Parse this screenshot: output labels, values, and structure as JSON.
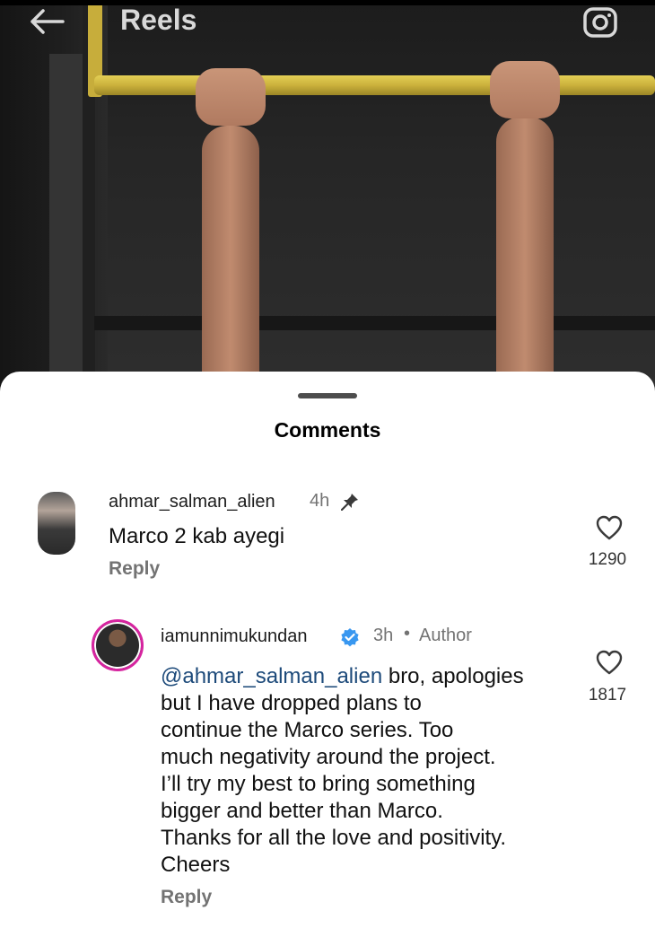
{
  "header": {
    "title": "Reels",
    "back_icon": "arrow-left-icon",
    "camera_icon": "camera-icon"
  },
  "sheet": {
    "title": "Comments"
  },
  "comments": [
    {
      "username": "ahmar_salman_alien",
      "time": "4h",
      "pinned": true,
      "text": "Marco 2 kab ayegi",
      "reply_label": "Reply",
      "likes": "1290"
    },
    {
      "username": "iamunnimukundan",
      "verified": true,
      "time": "3h",
      "separator": "•",
      "author_badge": "Author",
      "mention": "@ahmar_salman_alien",
      "text_lines": [
        " bro, apologies",
        "but I have dropped plans to",
        "continue the Marco series. Too",
        "much negativity around the project.",
        "I’ll try my best to bring something",
        "bigger and better than Marco.",
        "Thanks for all the love and positivity.",
        "Cheers"
      ],
      "reply_label": "Reply",
      "likes": "1817"
    }
  ],
  "colors": {
    "mention": "#1d4a7a",
    "meta": "#737373",
    "story_ring": "#d6249f",
    "verified": "#3897f0"
  }
}
